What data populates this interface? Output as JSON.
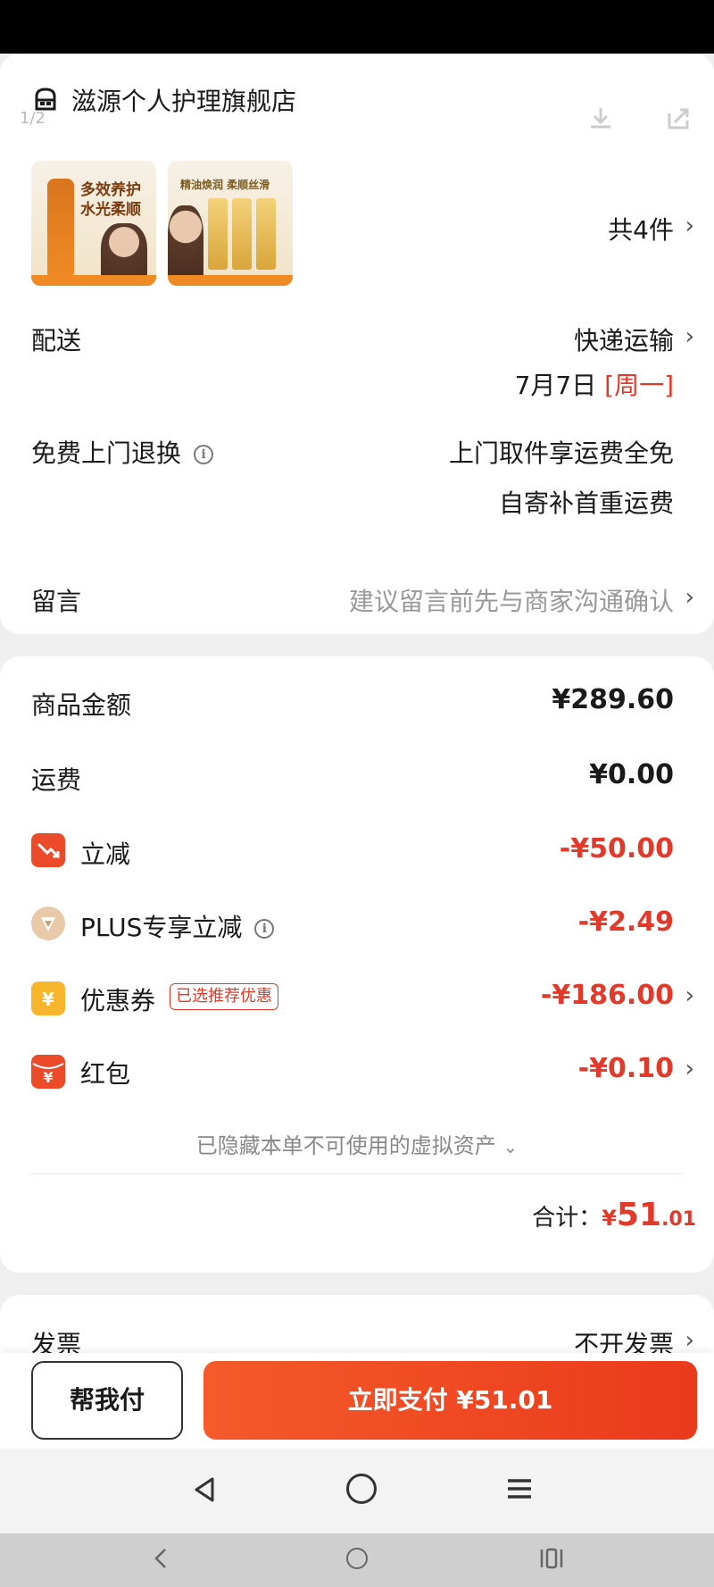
{
  "store": {
    "name": "滋源个人护理旗舰店",
    "page_indicator": "1/2"
  },
  "products": {
    "thumb1_caption": "多效养护\n水光柔顺",
    "thumb2_caption": "精油焕润 柔顺丝滑",
    "count_label": "共4件"
  },
  "delivery": {
    "label": "配送",
    "method": "快递运输",
    "date": "7月7日",
    "weekday": "[周一]"
  },
  "return_service": {
    "label": "免费上门退换",
    "line1": "上门取件享运费全免",
    "line2": "自寄补首重运费"
  },
  "message": {
    "label": "留言",
    "placeholder": "建议留言前先与商家沟通确认"
  },
  "summary": {
    "goods_label": "商品金额",
    "goods_value": "¥289.60",
    "shipping_label": "运费",
    "shipping_value": "¥0.00",
    "discount_label": "立减",
    "discount_value": "-¥50.00",
    "plus_label": "PLUS专享立减",
    "plus_value": "-¥2.49",
    "coupon_label": "优惠券",
    "coupon_tag": "已选推荐优惠",
    "coupon_value": "-¥186.00",
    "redpacket_label": "红包",
    "redpacket_value": "-¥0.10",
    "hidden_assets": "已隐藏本单不可使用的虚拟资产",
    "total_label": "合计：",
    "total_currency": "¥",
    "total_int": "51",
    "total_dec": ".01"
  },
  "invoice": {
    "label": "发票",
    "value": "不开发票"
  },
  "actions": {
    "help_pay": "帮我付",
    "pay_now": "立即支付 ¥51.01"
  },
  "colors": {
    "accent": "#e23a2a",
    "pay_button": "#f04a20"
  }
}
